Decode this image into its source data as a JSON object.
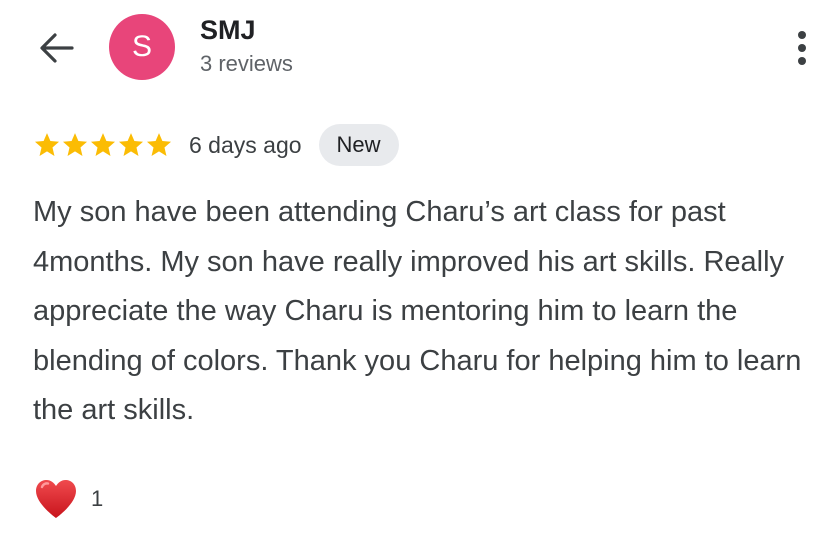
{
  "header": {
    "avatar_letter": "S",
    "reviewer_name": "SMJ",
    "review_count": "3 reviews",
    "back_icon": "arrow-back-icon",
    "more_icon": "more-vert-icon"
  },
  "review": {
    "rating": 5,
    "rating_max": 5,
    "date": "6 days ago",
    "badge": "New",
    "text": "My son have been attending Charu’s art class for past 4months. My son have really improved his art skills. Really appreciate the way Charu is mentoring him to learn the blending of colors. Thank you Charu for helping him to learn the art skills."
  },
  "reactions": {
    "icon": "heart-icon",
    "count": "1"
  },
  "colors": {
    "avatar_bg": "#e8457a",
    "star": "#fbbc04",
    "heart": "#e0262c",
    "badge_bg": "#e8eaed"
  }
}
